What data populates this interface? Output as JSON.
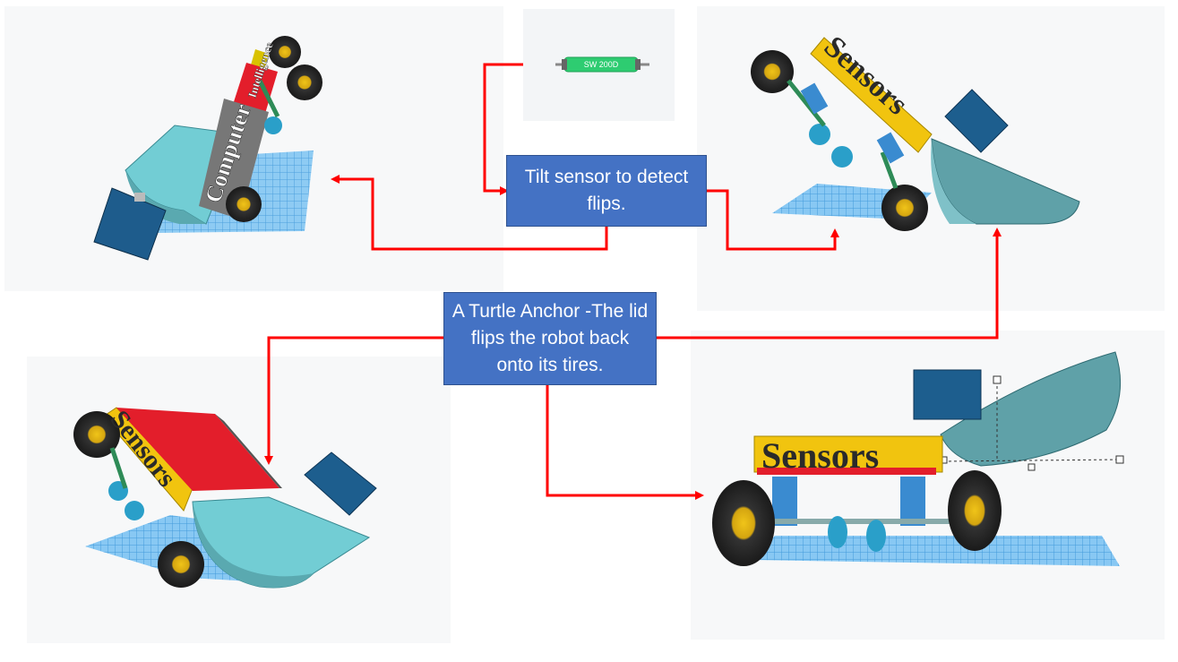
{
  "callouts": {
    "tilt": "Tilt sensor to detect flips.",
    "anchor": "A Turtle Anchor -The lid flips the robot back onto its tires."
  },
  "component": {
    "label": "SW 200D"
  },
  "panels": {
    "top_left": {
      "side_label_1": "Computer",
      "side_label_2": "Intelligence"
    },
    "top_right": {
      "side_label": "Sensors"
    },
    "bottom_left": {
      "side_label": "Sensors"
    },
    "bottom_right": {
      "side_label": "Sensors"
    }
  },
  "colors": {
    "callout": "#4472c4",
    "arrow": "#ff0000",
    "lid": "#5fa1a8",
    "grid": "#3aa0e8",
    "sensor_box": "#f1c40f",
    "red_top": "#e31e2b",
    "switch": "#2ecc71"
  }
}
